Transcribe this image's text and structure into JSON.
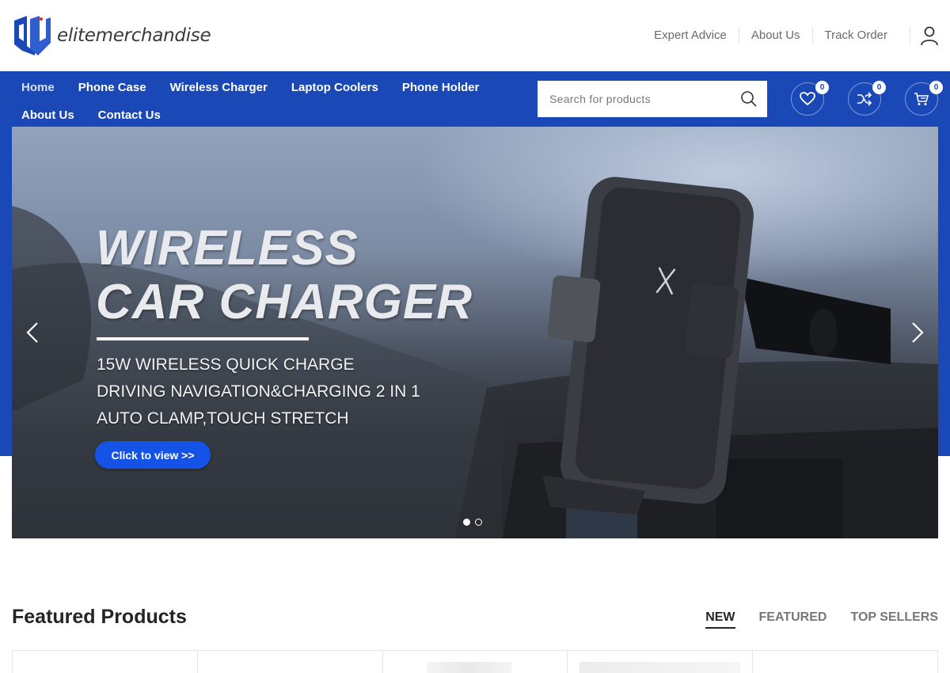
{
  "brand": {
    "name": "elitemerchandise",
    "accent": "#1a48b7"
  },
  "top_links": [
    "Expert Advice",
    "About Us",
    "Track Order"
  ],
  "nav": {
    "row1": [
      "Home",
      "Phone Case",
      "Wireless Charger",
      "Laptop Coolers",
      "Phone Holder"
    ],
    "row2": [
      "About Us",
      "Contact Us"
    ],
    "active": "Home"
  },
  "search": {
    "placeholder": "Search for products",
    "icon": "search-icon"
  },
  "header_icons": {
    "wishlist": {
      "icon": "heart-icon",
      "count": "0"
    },
    "compare": {
      "icon": "shuffle-icon",
      "count": "0"
    },
    "cart": {
      "icon": "cart-icon",
      "count": "0"
    }
  },
  "hero": {
    "title_line1": "WIRELESS",
    "title_line2": "CAR CHARGER",
    "features": [
      "15W WIRELESS QUICK CHARGE",
      "DRIVING NAVIGATION&CHARGING 2 IN 1",
      "AUTO CLAMP,TOUCH STRETCH"
    ],
    "cta": "Click to view >>",
    "slide_count": 2,
    "active_slide": 1
  },
  "featured": {
    "title": "Featured Products",
    "tabs": [
      "NEW",
      "FEATURED",
      "TOP SELLERS"
    ],
    "active_tab": "NEW"
  }
}
